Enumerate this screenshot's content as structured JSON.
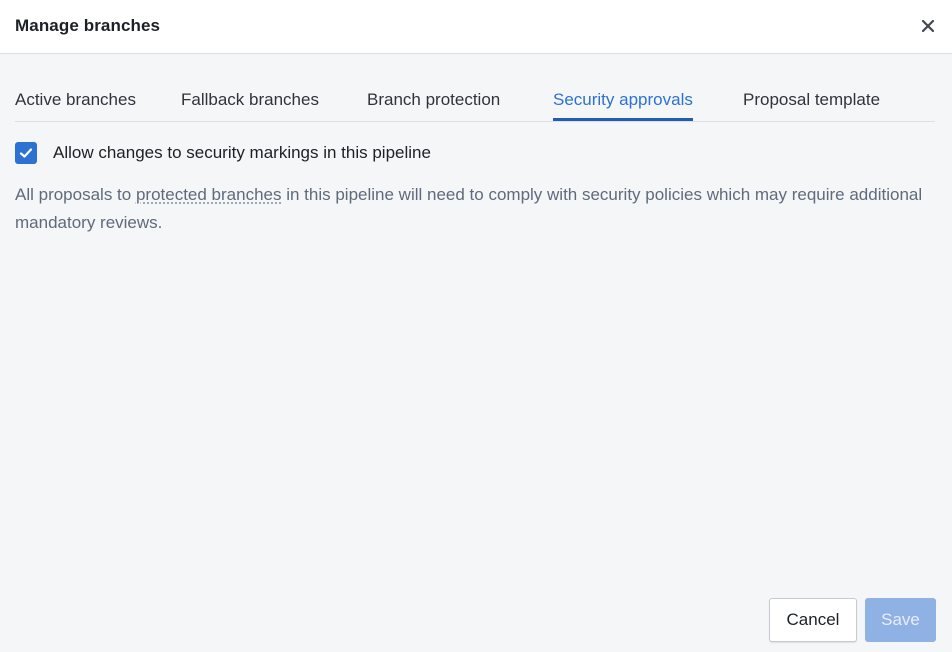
{
  "dialog": {
    "title": "Manage branches",
    "close_icon": "close-icon"
  },
  "tabs": [
    {
      "label": "Active branches",
      "active": false
    },
    {
      "label": "Fallback branches",
      "active": false
    },
    {
      "label": "Branch protection",
      "active": false
    },
    {
      "label": "Security approvals",
      "active": true
    },
    {
      "label": "Proposal template",
      "active": false
    }
  ],
  "security": {
    "checkbox_label": "Allow changes to security markings in this pipeline",
    "checkbox_checked": true,
    "description_before": "All proposals to ",
    "description_link": "protected branches",
    "description_after": " in this pipeline will need to comply with security policies which may require additional mandatory reviews."
  },
  "footer": {
    "cancel_label": "Cancel",
    "save_label": "Save",
    "save_disabled": true
  },
  "colors": {
    "accent": "#2d72d2",
    "save_disabled_bg": "#8fb1e3",
    "background": "#f5f6f8"
  }
}
